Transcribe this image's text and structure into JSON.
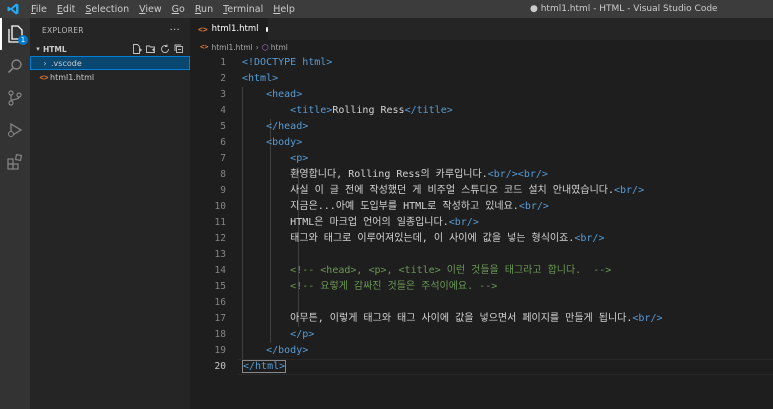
{
  "window": {
    "title": "● html1.html - HTML - Visual Studio Code",
    "menu": [
      "File",
      "Edit",
      "Selection",
      "View",
      "Go",
      "Run",
      "Terminal",
      "Help"
    ]
  },
  "activity": {
    "items": [
      "files-icon",
      "search-icon",
      "source-control-icon",
      "run-debug-icon",
      "extensions-icon"
    ],
    "badge": "1"
  },
  "sidebar": {
    "header": "EXPLORER",
    "more": "···",
    "section": "HTML",
    "tree": [
      {
        "name": ".vscode",
        "type": "folder"
      },
      {
        "name": "html1.html",
        "type": "file"
      }
    ]
  },
  "tab": {
    "label": "html1.html",
    "icon": "<>"
  },
  "breadcrumb": {
    "file": "html1.html",
    "element": "html"
  },
  "editor": {
    "line_numbers": [
      "1",
      "2",
      "3",
      "4",
      "5",
      "6",
      "7",
      "8",
      "9",
      "10",
      "11",
      "12",
      "13",
      "14",
      "15",
      "16",
      "17",
      "18",
      "19",
      "20"
    ],
    "current_line": 20,
    "lines": [
      [
        {
          "t": "tag",
          "v": "<!DOCTYPE html>"
        }
      ],
      [
        {
          "t": "tag",
          "v": "<html>"
        }
      ],
      [
        {
          "t": "txt",
          "v": "    "
        },
        {
          "t": "tag",
          "v": "<head>"
        }
      ],
      [
        {
          "t": "txt",
          "v": "        "
        },
        {
          "t": "tag",
          "v": "<title>"
        },
        {
          "t": "txt",
          "v": "Rolling Ress"
        },
        {
          "t": "tag",
          "v": "</title>"
        }
      ],
      [
        {
          "t": "txt",
          "v": "    "
        },
        {
          "t": "tag",
          "v": "</head>"
        }
      ],
      [
        {
          "t": "txt",
          "v": "    "
        },
        {
          "t": "tag",
          "v": "<body>"
        }
      ],
      [
        {
          "t": "txt",
          "v": "        "
        },
        {
          "t": "tag",
          "v": "<p>"
        }
      ],
      [
        {
          "t": "txt",
          "v": "        환영합니다, Rolling Ress의 카루입니다."
        },
        {
          "t": "tag",
          "v": "<br/><br/>"
        }
      ],
      [
        {
          "t": "txt",
          "v": "        사실 이 글 전에 작성했던 게 비주얼 스튜디오 코드 설치 안내였습니다."
        },
        {
          "t": "tag",
          "v": "<br/>"
        }
      ],
      [
        {
          "t": "txt",
          "v": "        지금은...아예 도입부를 HTML로 작성하고 있네요."
        },
        {
          "t": "tag",
          "v": "<br/>"
        }
      ],
      [
        {
          "t": "txt",
          "v": "        HTML은 마크업 언어의 일종입니다."
        },
        {
          "t": "tag",
          "v": "<br/>"
        }
      ],
      [
        {
          "t": "txt",
          "v": "        태그와 태그로 이루어져있는데, 이 사이에 값을 넣는 형식이죠."
        },
        {
          "t": "tag",
          "v": "<br/>"
        }
      ],
      [
        {
          "t": "txt",
          "v": ""
        }
      ],
      [
        {
          "t": "txt",
          "v": "        "
        },
        {
          "t": "cmt",
          "v": "<!-- <head>, <p>, <title> 이런 것들을 태그라고 합니다.  -->"
        }
      ],
      [
        {
          "t": "txt",
          "v": "        "
        },
        {
          "t": "cmt",
          "v": "<!-- 요렇게 감싸진 것들은 주석이에요. -->"
        }
      ],
      [
        {
          "t": "txt",
          "v": ""
        }
      ],
      [
        {
          "t": "txt",
          "v": "        아무튼, 이렇게 태그와 태그 사이에 값을 넣으면서 페이지를 만들게 됩니다."
        },
        {
          "t": "tag",
          "v": "<br/>"
        }
      ],
      [
        {
          "t": "txt",
          "v": "        "
        },
        {
          "t": "tag",
          "v": "</p>"
        }
      ],
      [
        {
          "t": "txt",
          "v": "    "
        },
        {
          "t": "tag",
          "v": "</body>"
        }
      ],
      [
        {
          "t": "tag",
          "v": "</html>"
        }
      ]
    ]
  },
  "colors": {
    "tag": "#569cd6",
    "comment": "#6a9955",
    "text": "#d4d4d4",
    "accent": "#007acc",
    "selection": "#094771"
  }
}
